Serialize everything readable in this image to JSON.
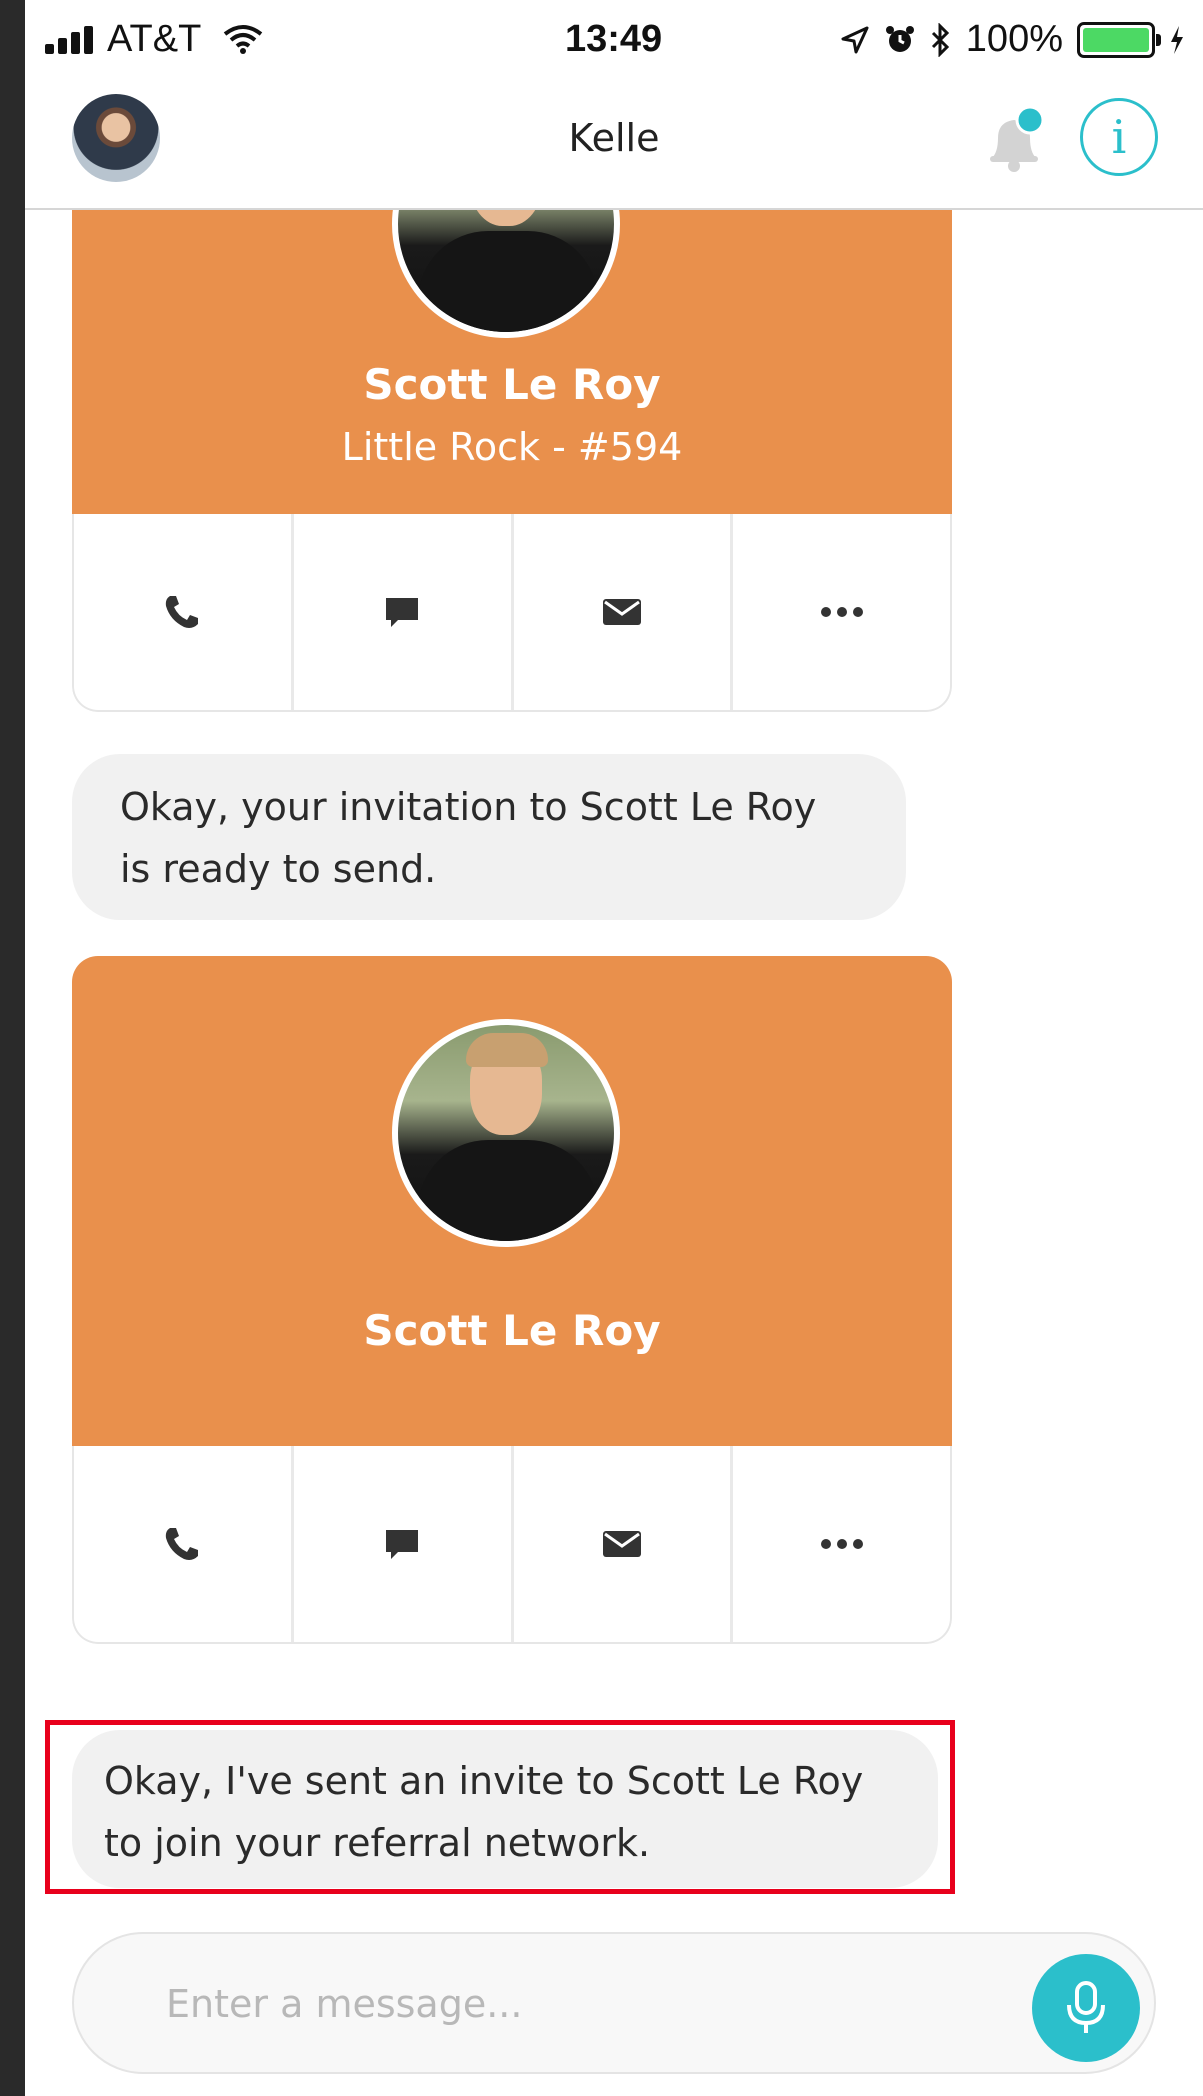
{
  "status_bar": {
    "carrier": "AT&T",
    "time": "13:49",
    "battery": "100%"
  },
  "header": {
    "title": "Kelle",
    "avatar_icon": "user-avatar",
    "notification_icon": "bell-icon",
    "info_icon": "info-icon",
    "info_glyph": "i"
  },
  "cards": [
    {
      "name": "Scott Le Roy",
      "subtitle": "Little Rock - #594",
      "actions": [
        "phone-icon",
        "chat-icon",
        "mail-icon",
        "more-icon"
      ]
    },
    {
      "name": "Scott Le Roy",
      "subtitle": "",
      "actions": [
        "phone-icon",
        "chat-icon",
        "mail-icon",
        "more-icon"
      ]
    }
  ],
  "messages": [
    {
      "lines": [
        "Okay, your invitation to Scott Le Roy",
        "is ready to send."
      ]
    },
    {
      "lines": [
        "Okay, I've sent an invite to Scott Le Roy",
        "to join your referral network."
      ]
    }
  ],
  "composer": {
    "placeholder": "Enter a message...",
    "mic_icon": "microphone-icon"
  },
  "colors": {
    "card_orange": "#e9904c",
    "accent_teal": "#2bbfcb",
    "bubble_gray": "#f1f1f1",
    "highlight_red": "#e8001c"
  }
}
